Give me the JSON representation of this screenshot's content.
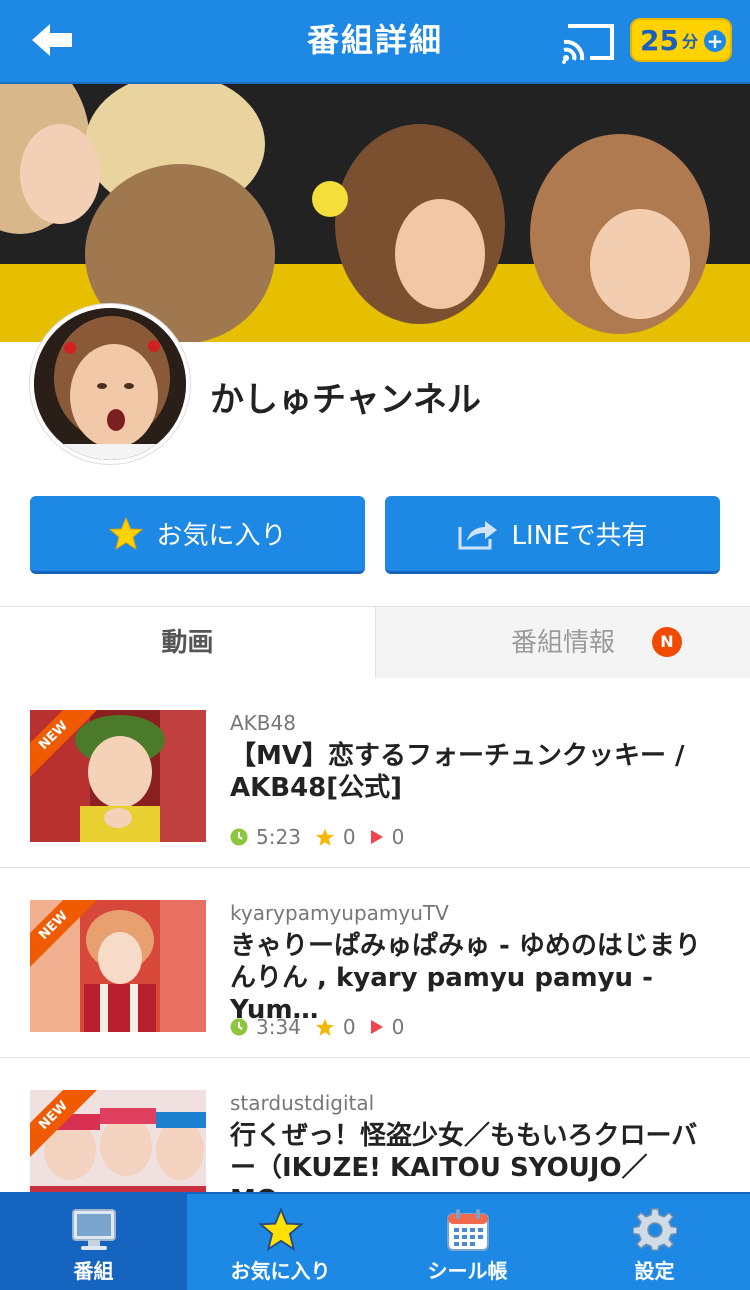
{
  "header": {
    "title": "番組詳細",
    "time_value": "25",
    "time_unit": "分",
    "time_plus": "+"
  },
  "channel": {
    "name": "かしゅチャンネル"
  },
  "actions": {
    "favorite_label": "お気に入り",
    "share_label": "LINEで共有"
  },
  "tabs": {
    "videos": "動画",
    "info": "番組情報",
    "info_badge": "N"
  },
  "videos": [
    {
      "badge": "NEW",
      "channel": "AKB48",
      "title": "【MV】恋するフォーチュンクッキー / AKB48[公式]",
      "duration": "5:23",
      "stars": "0",
      "plays": "0"
    },
    {
      "badge": "NEW",
      "channel": "kyarypamyupamyuTV",
      "title": "きゃりーぱみゅぱみゅ - ゆめのはじまりんりん , kyary pamyu pamyu - Yum…",
      "duration": "3:34",
      "stars": "0",
      "plays": "0"
    },
    {
      "badge": "NEW",
      "channel": "stardustdigital",
      "title": "行くぜっ！怪盗少女／ももいろクローバー（IKUZE! KAITOU SYOUJO／MO…",
      "duration": "",
      "stars": "",
      "plays": ""
    }
  ],
  "bottom_nav": [
    {
      "label": "番組",
      "icon": "monitor-icon",
      "active": true
    },
    {
      "label": "お気に入り",
      "icon": "star-icon",
      "active": false
    },
    {
      "label": "シール帳",
      "icon": "calendar-icon",
      "active": false
    },
    {
      "label": "設定",
      "icon": "gear-icon",
      "active": false
    }
  ],
  "colors": {
    "primary": "#1e88e5",
    "primary_dark": "#1565c0",
    "badge_yellow": "#ffd200",
    "new_orange": "#f05a00",
    "clock_green": "#8cc63f",
    "star_yellow": "#f5b800",
    "play_red": "#f0444a"
  }
}
